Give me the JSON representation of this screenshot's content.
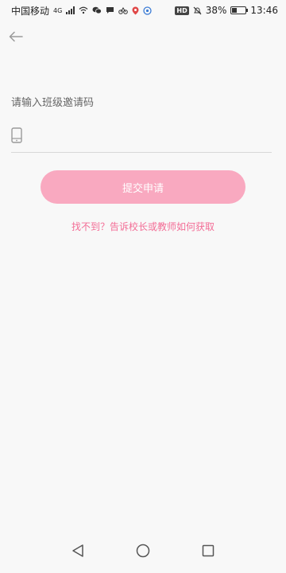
{
  "status_bar": {
    "carrier": "中国移动",
    "network": "4G",
    "battery": "38%",
    "battery_level": 0.38,
    "time": "13:46",
    "hd": "HD"
  },
  "page": {
    "prompt": "请输入班级邀请码",
    "input_value": "",
    "input_placeholder": "",
    "submit_label": "提交申请",
    "help_link": "找不到？告诉校长或教师如何获取"
  },
  "colors": {
    "accent": "#f9a9c0",
    "link": "#f36d96",
    "icon_gray": "#999999"
  },
  "icons": {
    "back": "arrow-left-icon",
    "phone": "phone-icon",
    "nav_back": "triangle-back-icon",
    "nav_home": "circle-home-icon",
    "nav_recent": "square-recent-icon"
  }
}
